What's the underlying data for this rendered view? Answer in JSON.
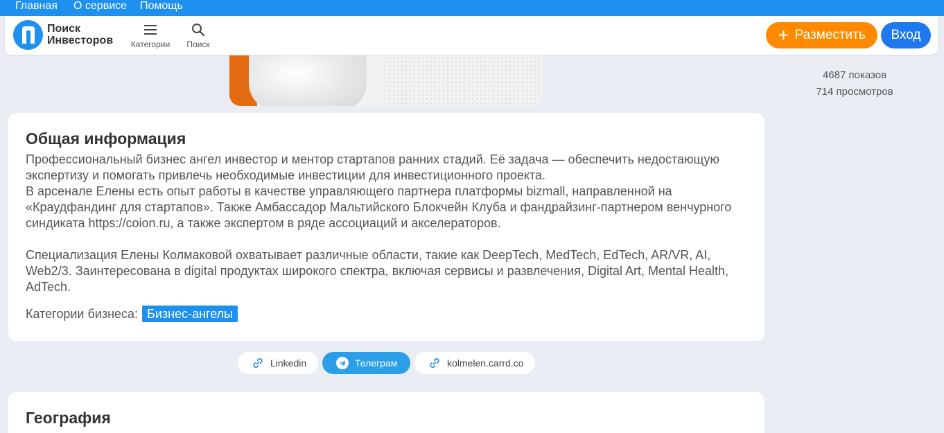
{
  "topnav": [
    {
      "label": "Главная"
    },
    {
      "label": "О сервисе"
    },
    {
      "label": "Помощь"
    }
  ],
  "header": {
    "logo_line1": "Поиск",
    "logo_line2": "Инвесторов",
    "categories_label": "Категории",
    "search_label": "Поиск",
    "post_label": "Разместить",
    "login_label": "Вход"
  },
  "stats": {
    "impressions": "4687 показов",
    "views": "714 просмотров"
  },
  "info": {
    "title": "Общая информация",
    "para1": "Профессиональный бизнес ангел инвестор и ментор стартапов ранних стадий. Её задача — обеспечить недостающую экспертизу и помогать привлечь необходимые инвестиции для инвестиционного проекта.",
    "para2": "В арсенале Елены есть опыт работы в качестве управляющего партнера платформы bizmall, направленной на «Краудфандинг для стартапов». Также Амбассадор Мальтийского Блокчейн Клуба и фандрайзинг-партнером венчурного синдиката https://coion.ru, а также экспертом в ряде ассоциаций и акселераторов.",
    "para3": "Специализация Елены Колмаковой охватывает различные области, такие как DeepTech, MedTech, EdTech, AR/VR, AI, Web2/3. Заинтересована в digital продуктах широкого спектра, включая сервисы и развлечения, Digital Art, Mental Health, AdTech.",
    "categories_label": "Категории бизнеса:",
    "category_tag": "Бизнес-ангелы"
  },
  "links": [
    {
      "label": "Linkedin",
      "icon": "link-icon"
    },
    {
      "label": "Телеграм",
      "icon": "telegram-icon"
    },
    {
      "label": "kolmelen.carrd.co",
      "icon": "link-icon"
    }
  ],
  "geo": {
    "title": "География"
  },
  "colors": {
    "accent": "#1e90f0",
    "post_button": "#ff8a00",
    "login_button": "#1e78f0",
    "telegram": "#2a9ee6"
  }
}
